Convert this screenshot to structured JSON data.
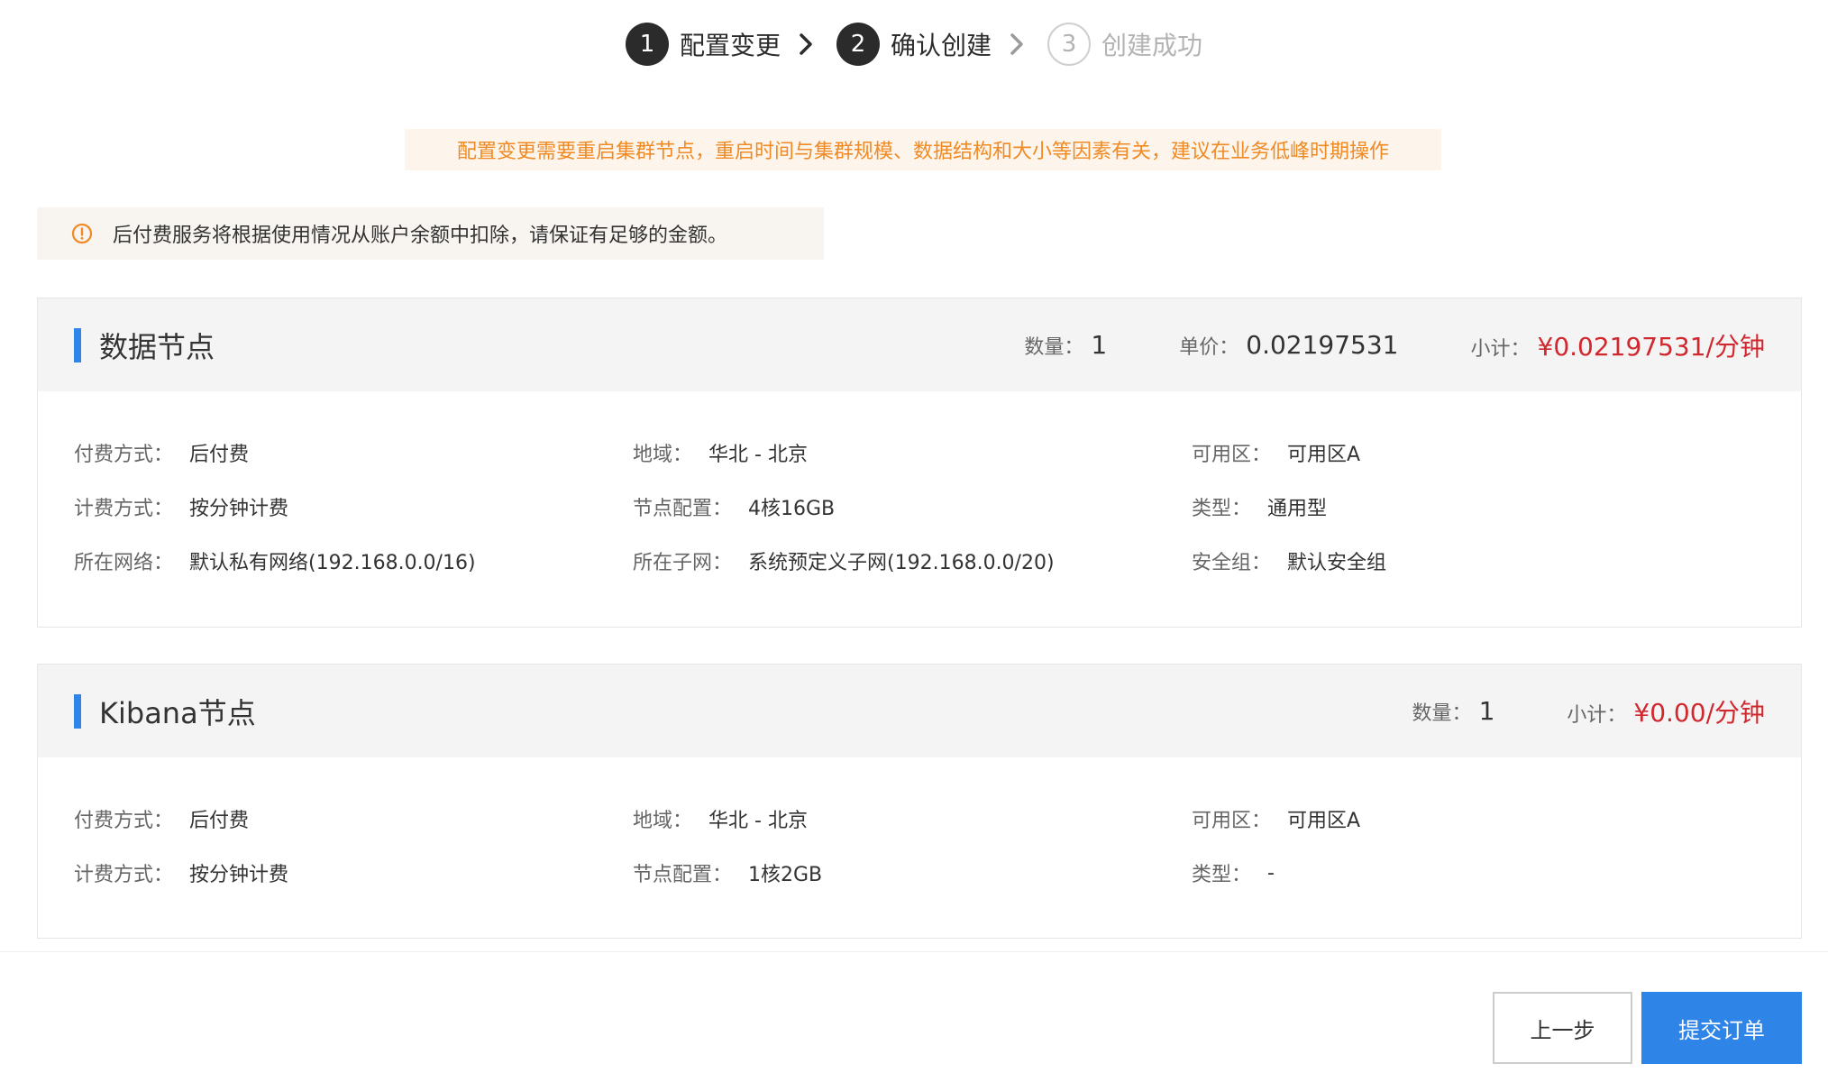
{
  "steps": [
    {
      "num": "1",
      "label": "配置变更",
      "state": "done"
    },
    {
      "num": "2",
      "label": "确认创建",
      "state": "active"
    },
    {
      "num": "3",
      "label": "创建成功",
      "state": "pending"
    }
  ],
  "warning_text": "配置变更需要重启集群节点，重启时间与集群规模、数据结构和大小等因素有关，建议在业务低峰时期操作",
  "info_text": "后付费服务将根据使用情况从账户余额中扣除，请保证有足够的金额。",
  "colors": {
    "accent": "#2f84e8",
    "warning": "#f08a24",
    "price": "#d0282e",
    "step_active": "#2b2b2b"
  },
  "data_node": {
    "title": "数据节点",
    "qty_label": "数量：",
    "qty": "1",
    "unit_label": "单价：",
    "unit_price": "0.02197531",
    "subtotal_label": "小计：",
    "subtotal": "¥0.02197531/分钟",
    "fields": [
      {
        "key": "付费方式：",
        "value": "后付费"
      },
      {
        "key": "地域：",
        "value": "华北 - 北京"
      },
      {
        "key": "可用区：",
        "value": "可用区A"
      },
      {
        "key": "计费方式：",
        "value": "按分钟计费"
      },
      {
        "key": "节点配置：",
        "value": "4核16GB"
      },
      {
        "key": "类型：",
        "value": "通用型"
      },
      {
        "key": "所在网络：",
        "value": "默认私有网络(192.168.0.0/16)"
      },
      {
        "key": "所在子网：",
        "value": "系统预定义子网(192.168.0.0/20)"
      },
      {
        "key": "安全组：",
        "value": "默认安全组"
      }
    ]
  },
  "kibana_node": {
    "title": "Kibana节点",
    "qty_label": "数量：",
    "qty": "1",
    "subtotal_label": "小计：",
    "subtotal": "¥0.00/分钟",
    "fields": [
      {
        "key": "付费方式：",
        "value": "后付费"
      },
      {
        "key": "地域：",
        "value": "华北 - 北京"
      },
      {
        "key": "可用区：",
        "value": "可用区A"
      },
      {
        "key": "计费方式：",
        "value": "按分钟计费"
      },
      {
        "key": "节点配置：",
        "value": "1核2GB"
      },
      {
        "key": "类型：",
        "value": "-"
      }
    ]
  },
  "footer": {
    "prev_label": "上一步",
    "submit_label": "提交订单"
  }
}
